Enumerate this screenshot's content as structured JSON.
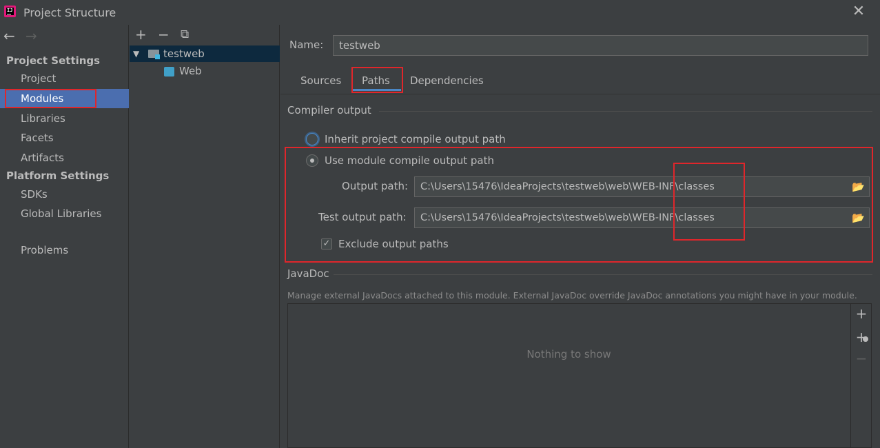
{
  "window": {
    "title": "Project Structure",
    "close_label": "✕"
  },
  "nav": {
    "back": "←",
    "forward": "→"
  },
  "sidebar": {
    "project_settings_header": "Project Settings",
    "platform_settings_header": "Platform Settings",
    "items": [
      {
        "label": "Project"
      },
      {
        "label": "Modules"
      },
      {
        "label": "Libraries"
      },
      {
        "label": "Facets"
      },
      {
        "label": "Artifacts"
      },
      {
        "label": "SDKs"
      },
      {
        "label": "Global Libraries"
      },
      {
        "label": "Problems"
      }
    ],
    "selected": "Modules"
  },
  "module_toolbar": {
    "add": "+",
    "remove": "−",
    "copy": "⧉"
  },
  "tree": {
    "module": "testweb",
    "facet": "Web"
  },
  "module_form": {
    "name_label": "Name:",
    "name_value": "testweb",
    "tabs": [
      "Sources",
      "Paths",
      "Dependencies"
    ],
    "active_tab": "Paths"
  },
  "compiler_output": {
    "title": "Compiler output",
    "inherit_label": "Inherit project compile output path",
    "use_module_label": "Use module compile output path",
    "output_path_label": "Output path:",
    "output_path_value": "C:\\Users\\15476\\IdeaProjects\\testweb\\web\\WEB-INF\\classes",
    "test_output_path_label": "Test output path:",
    "test_output_path_value": "C:\\Users\\15476\\IdeaProjects\\testweb\\web\\WEB-INF\\classes",
    "exclude_label": "Exclude output paths",
    "exclude_checked": "✓"
  },
  "javadoc": {
    "title": "JavaDoc",
    "description": "Manage external JavaDocs attached to this module. External JavaDoc override JavaDoc annotations you might have in your module.",
    "empty_text": "Nothing to show",
    "add": "+",
    "add_url": "+",
    "remove": "−"
  },
  "colors": {
    "background": "#3c3f41",
    "selection": "#4b6eaf",
    "highlight_box": "#e0262b",
    "tab_underline": "#4a88c7"
  }
}
